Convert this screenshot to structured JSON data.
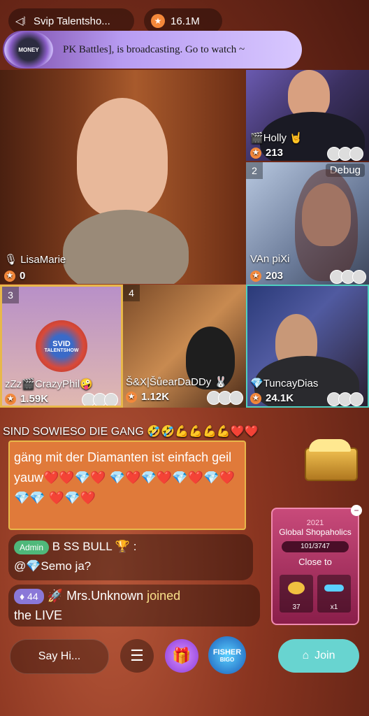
{
  "top": {
    "room_name": "Svip Talentsho...",
    "coins": "16.1M",
    "banner_text": "PK Battles], is broadcasting. Go to watch ~",
    "banner_badge": "MONEY"
  },
  "seats": {
    "main": {
      "name": "LisaMarie",
      "score": "0"
    },
    "holly": {
      "name": "Holly",
      "score": "213"
    },
    "vanpixi": {
      "num": "2",
      "name": "VAn  piXi",
      "score": "203",
      "debug": "Debug"
    },
    "crazy": {
      "num": "3",
      "name": "zZz🎬CrazyPhil",
      "score": "1.59K",
      "logo_top": "SVID",
      "logo_bottom": "TALENTSHOW"
    },
    "sugar": {
      "num": "4",
      "name": "Š&X|ŠůearDaDDy",
      "score": "1.12K"
    },
    "tuncay": {
      "name": "TuncayDias",
      "score": "24.1K"
    }
  },
  "chat": {
    "marquee": "SIND SOWIESO DIE GANG 🤣🤣💪💪💪💪❤️❤️",
    "big_message": "gäng mit der Diamanten ist einfach geil yauw❤️❤️💎❤️ 💎❤️💎❤️💎❤️💎❤️💎💎 ❤️💎❤️",
    "admin_badge": "Admin",
    "admin_user": "B SS BULL",
    "admin_colon": ":",
    "admin_text": "@💎Semo ja?",
    "join_level": "44",
    "join_user": "Mrs.Unknown",
    "join_text": "joined",
    "join_text2": "the LIVE"
  },
  "shop": {
    "year": "2021",
    "title": "Global Shopaholics",
    "progress": "101/3747",
    "close_to": "Close to",
    "tile1": "37",
    "tile2": "x1"
  },
  "bottom": {
    "say_hi": "Say Hi...",
    "fisher_top": "FISHER",
    "fisher_bottom": "BIGO",
    "join_label": "Join"
  }
}
